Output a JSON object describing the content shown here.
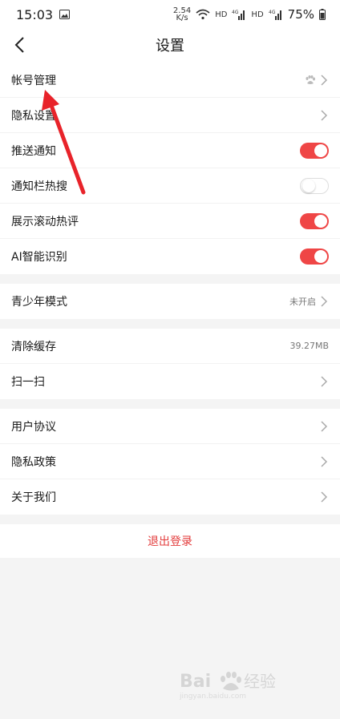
{
  "status_bar": {
    "time": "15:03",
    "net_speed_top": "2.54",
    "net_speed_bottom": "K/s",
    "hd1": "HD",
    "hd2": "HD",
    "signal_label": "4G",
    "battery": "75%"
  },
  "header": {
    "title": "设置"
  },
  "groups": [
    {
      "rows": [
        {
          "label": "帐号管理"
        },
        {
          "label": "隐私设置"
        },
        {
          "label": "推送通知",
          "toggle": true
        },
        {
          "label": "通知栏热搜",
          "toggle": false
        },
        {
          "label": "展示滚动热评",
          "toggle": true
        },
        {
          "label": "AI智能识别",
          "toggle": true
        }
      ]
    },
    {
      "rows": [
        {
          "label": "青少年模式",
          "value": "未开启"
        }
      ]
    },
    {
      "rows": [
        {
          "label": "清除缓存",
          "value": "39.27MB"
        },
        {
          "label": "扫一扫"
        }
      ]
    },
    {
      "rows": [
        {
          "label": "用户协议"
        },
        {
          "label": "隐私政策"
        },
        {
          "label": "关于我们"
        }
      ]
    }
  ],
  "logout_label": "退出登录",
  "colors": {
    "accent": "#ef4646",
    "logout_text": "#e33c3c",
    "background": "#f4f4f4"
  }
}
